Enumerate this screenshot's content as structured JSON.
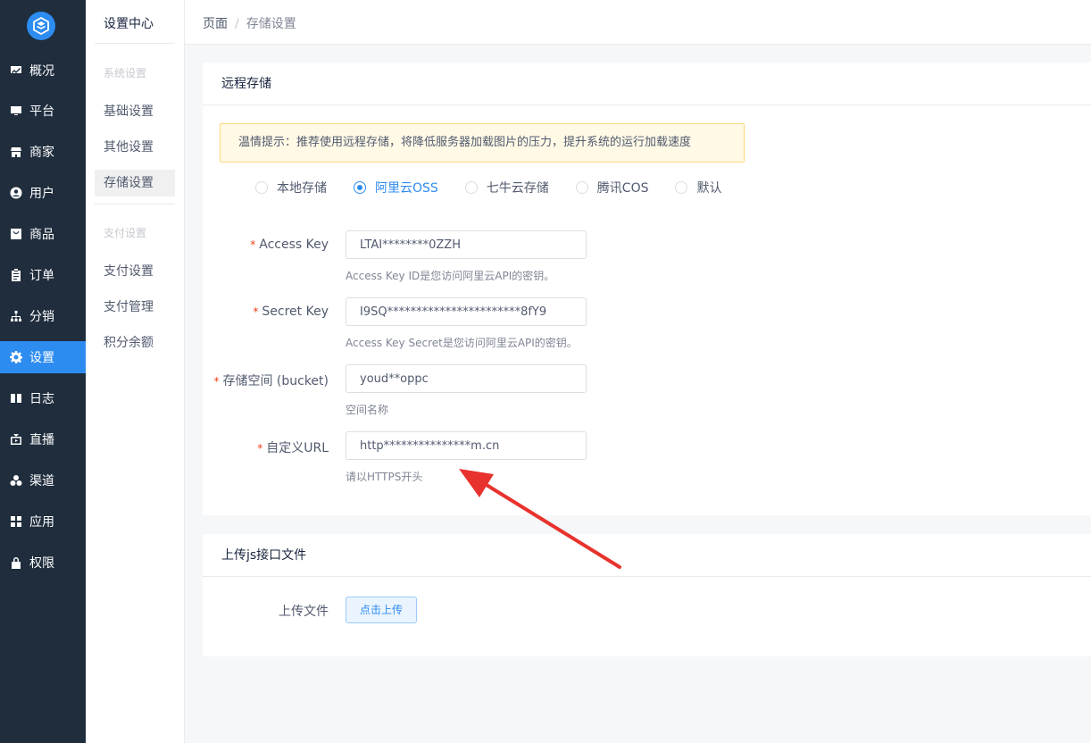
{
  "nav": {
    "items": [
      {
        "label": "概况",
        "icon": "overview-icon"
      },
      {
        "label": "平台",
        "icon": "monitor-icon"
      },
      {
        "label": "商家",
        "icon": "store-icon"
      },
      {
        "label": "用户",
        "icon": "user-icon"
      },
      {
        "label": "商品",
        "icon": "bag-icon"
      },
      {
        "label": "订单",
        "icon": "clipboard-icon"
      },
      {
        "label": "分销",
        "icon": "hierarchy-icon"
      },
      {
        "label": "设置",
        "icon": "gear-icon"
      },
      {
        "label": "日志",
        "icon": "book-icon"
      },
      {
        "label": "直播",
        "icon": "tv-icon"
      },
      {
        "label": "渠道",
        "icon": "cluster-icon"
      },
      {
        "label": "应用",
        "icon": "grid-icon"
      },
      {
        "label": "权限",
        "icon": "lock-icon"
      }
    ],
    "active_index": 7,
    "accent": "#2d8cf0",
    "background": "#1f2d3d"
  },
  "submenu": {
    "title": "设置中心",
    "group1": "系统设置",
    "items1": [
      "基础设置",
      "其他设置",
      "存储设置"
    ],
    "group2": "支付设置",
    "items2": [
      "支付设置",
      "支付管理",
      "积分余额"
    ]
  },
  "breadcrumb": {
    "root": "页面",
    "separator": "/",
    "current": "存储设置"
  },
  "remote": {
    "title": "远程存储",
    "tip": "温情提示：推荐使用远程存储，将降低服务器加载图片的压力，提升系统的运行加载速度",
    "options": [
      "本地存储",
      "阿里云OSS",
      "七牛云存储",
      "腾讯COS",
      "默认"
    ],
    "selected_index": 1,
    "fields": {
      "access_key": {
        "label": "Access Key",
        "value": "LTAI********0ZZH",
        "help": "Access Key ID是您访问阿里云API的密钥。"
      },
      "secret_key": {
        "label": "Secret Key",
        "value": "I9SQ***********************8fY9",
        "help": "Access Key Secret是您访问阿里云API的密钥。"
      },
      "bucket": {
        "label": "存储空间 (bucket)",
        "value": "youd**oppc",
        "help": "空间名称"
      },
      "custom_url": {
        "label": "自定义URL",
        "value": "http***************m.cn",
        "help": "请以HTTPS开头"
      }
    },
    "required_mark": "*"
  },
  "upload": {
    "title": "上传js接口文件",
    "label": "上传文件",
    "button": "点击上传"
  },
  "annotation_color": "#e8322d"
}
